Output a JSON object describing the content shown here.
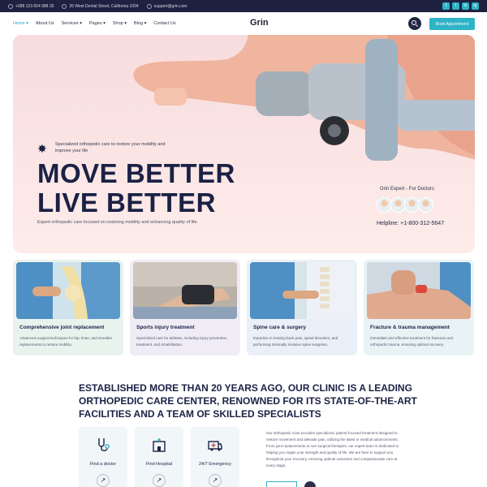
{
  "topbar": {
    "phone": "+088 123 654 988 35",
    "address": "35 West Dental Street, California 1004",
    "email": "support@grin.com",
    "social": [
      "f",
      "t",
      "in",
      "ig"
    ]
  },
  "nav": {
    "logo": "Grin",
    "menu": [
      "Home",
      "About Us",
      "Services",
      "Pages",
      "Shop",
      "Blog",
      "Contact Us"
    ],
    "appointment_label": "Book Appointment"
  },
  "hero": {
    "tagline": "Specialized orthopedic care to restore your mobility and improve your life",
    "headline_line1": "MOVE BETTER",
    "headline_line2": "LIVE BETTER",
    "description": "Expert orthopedic care focused on restoring mobility and enhancing quality of life.",
    "expert_label": "Grin Expert - For Doctors",
    "helpline": "Helpline: +1-800-312-5647"
  },
  "cards": [
    {
      "title": "Comprehensive joint replacement",
      "desc": "Advanced surgical techniques for hip, knee, and shoulder replacements to restore mobility.",
      "bg": "#e9f3ee"
    },
    {
      "title": "Sports injury treatment",
      "desc": "Specialized care for athletes, including injury prevention, treatment, and rehabilitation.",
      "bg": "#f0ecf6"
    },
    {
      "title": "Spine care & surgery",
      "desc": "Expertise in treating back pain, spinal disorders, and performing minimally invasive spine surgeries.",
      "bg": "#eaf0f7"
    },
    {
      "title": "Fracture & trauma management",
      "desc": "Immediate and effective treatment for fractures and orthopedic trauma, ensuring optimal recovery.",
      "bg": "#e8f3f6"
    }
  ],
  "established": "ESTABLISHED MORE THAN 20 YEARS AGO, OUR CLINIC IS A LEADING ORTHOPEDIC CARE CENTER, RENOWNED FOR ITS STATE-OF-THE-ART FACILITIES AND A TEAM OF SKILLED SPECIALISTS",
  "features": [
    {
      "label": "Find a doctor",
      "icon": "stethoscope-icon"
    },
    {
      "label": "Find Hospital",
      "icon": "hospital-icon"
    },
    {
      "label": "24/7 Emergency",
      "icon": "ambulance-icon"
    }
  ],
  "about_text": "Our Orthopedic Care provides specialized, patient-focused treatment designed to restore movement and alleviate pain, utilizing the latest in medical advancements. From joint replacements to non-surgical therapies, our expert team is dedicated to helping you regain your strength and quality of life. We are here to support you throughout your recovery, ensuring optimal outcomes and compassionate care at every stage.",
  "colors": {
    "accent": "#2fb3c6",
    "dark": "#1b2145",
    "topbar": "#1e2140"
  }
}
